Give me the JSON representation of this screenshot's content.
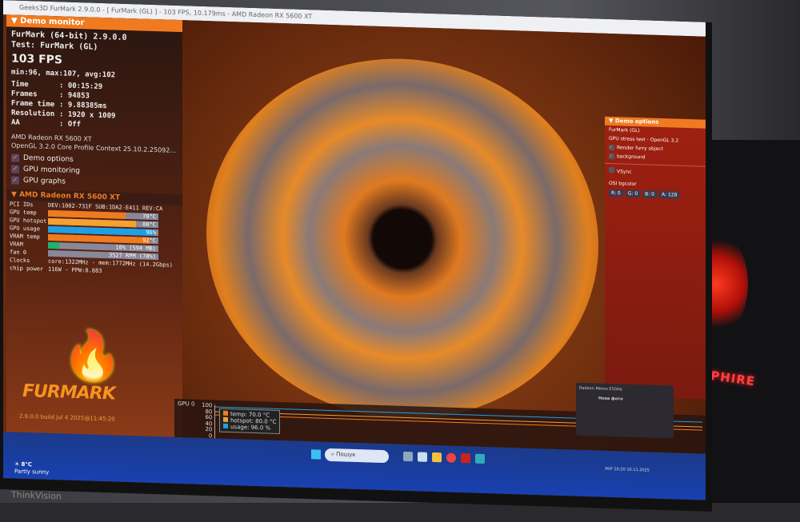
{
  "window_title": "Geeks3D FurMark 2.9.0.0 - [ FurMark (GL) ] - 103 FPS, 10.179ms - AMD Radeon RX 5600 XT",
  "monitor": {
    "header": "Demo monitor",
    "app": "FurMark (64-bit) 2.9.0.0",
    "test": "Test: FurMark (GL)",
    "fps": "103 FPS",
    "stats": "min:96, max:107, avg:102",
    "info": [
      {
        "k": "Time",
        "v": ": 00:15:29"
      },
      {
        "k": "Frames",
        "v": ": 94853"
      },
      {
        "k": "Frame time",
        "v": ": 9.88385ms"
      },
      {
        "k": "Resolution",
        "v": ": 1920 x 1009"
      },
      {
        "k": "AA",
        "v": ": Off"
      }
    ],
    "gpu_name": "AMD Radeon RX 5600 XT",
    "opengl": "OpenGL 3.2.0 Core Profile Context 25.10.2.25092...",
    "checks": [
      "Demo options",
      "GPU monitoring",
      "GPU graphs"
    ]
  },
  "gpu": {
    "header": "AMD Radeon RX 5600 XT",
    "pci_label": "PCI IDs",
    "pci": "DEV:1002-731F SUB:1DA2-E411 REV:CA",
    "bars": [
      {
        "label": "GPU temp",
        "text": "70°C",
        "pct": 70,
        "color": "#f07a20"
      },
      {
        "label": "GPU hotspot",
        "text": "80°C",
        "pct": 80,
        "color": "#f5a030"
      },
      {
        "label": "GPU usage",
        "text": "96%",
        "pct": 96,
        "color": "#1ea0e8"
      },
      {
        "label": "VRAM temp",
        "text": "92°C",
        "pct": 92,
        "color": "#f07a20"
      },
      {
        "label": "VRAM",
        "text": "10% (594 MB)",
        "pct": 10,
        "color": "#20b070"
      },
      {
        "label": "fan 0",
        "text": "3527 RPM (78%)",
        "pct": 0,
        "color": "#889"
      }
    ],
    "clocks_label": "Clocks",
    "clocks": "core:1322MHz - mem:1772MHz (14.2Gbps)",
    "power_label": "chip power",
    "power": "116W - PPW:0.883"
  },
  "logo": "FURMARK",
  "build": "2.9.0.0 build Jul  4 2025@11:45:20",
  "options": {
    "header": "Demo options",
    "name": "FurMark (GL)",
    "desc": "GPU stress test - OpenGL 3.2",
    "items": [
      "Render furry object",
      "background"
    ],
    "vsync": "VSync",
    "osd_label": "OSI bgcolor",
    "osd": [
      "R: 0",
      "G: 0",
      "B: 0",
      "A: 128"
    ]
  },
  "graph": {
    "label": "GPU 0",
    "ticks": [
      "100",
      "80",
      "60",
      "40",
      "20",
      "0"
    ],
    "legend": [
      "temp: 70.0 °C",
      "hotspot: 80.0 °C",
      "usage: 96.0 %"
    ]
  },
  "taskbar": {
    "search": "Пошук",
    "weather_temp": "8°C",
    "weather_desc": "Partly sunny",
    "time": "10:20",
    "date": "10.11.2025",
    "lang": "УКР"
  },
  "notification": {
    "title": "Radeon Memo ESSHe",
    "heading": "Нова фото"
  },
  "case_brand": "SAPPHIRE",
  "monitor_brand": "ThinkVision"
}
